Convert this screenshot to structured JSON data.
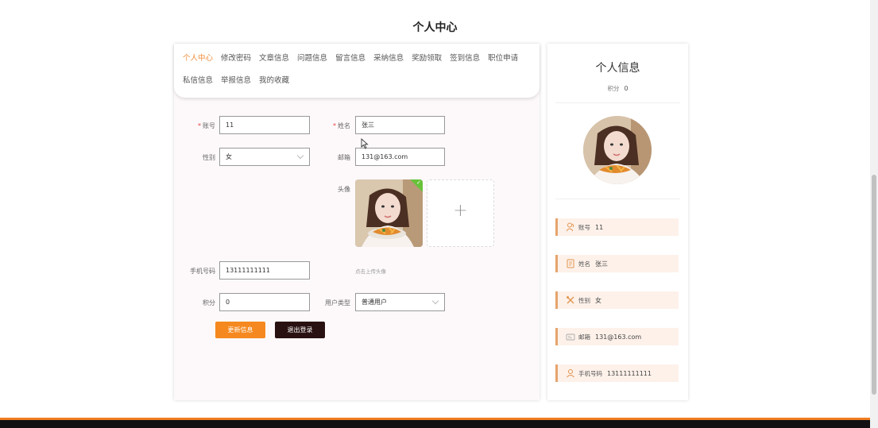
{
  "page": {
    "title": "个人中心"
  },
  "tabs": [
    {
      "label": "个人中心",
      "active": true
    },
    {
      "label": "修改密码"
    },
    {
      "label": "文章信息"
    },
    {
      "label": "问题信息"
    },
    {
      "label": "留言信息"
    },
    {
      "label": "采纳信息"
    },
    {
      "label": "奖励领取"
    },
    {
      "label": "签到信息"
    },
    {
      "label": "职位申请"
    },
    {
      "label": "私信信息"
    },
    {
      "label": "举报信息"
    },
    {
      "label": "我的收藏"
    }
  ],
  "form": {
    "account": {
      "label": "账号",
      "value": "11"
    },
    "name": {
      "label": "姓名",
      "value": "张三"
    },
    "gender": {
      "label": "性别",
      "value": "女"
    },
    "email": {
      "label": "邮箱",
      "value": "131@163.com"
    },
    "avatar": {
      "label": "头像",
      "tip": "点击上传头像"
    },
    "phone": {
      "label": "手机号码",
      "value": "13111111111"
    },
    "points": {
      "label": "积分",
      "value": "0"
    },
    "user_type": {
      "label": "用户类型",
      "value": "普通用户"
    },
    "update_button": "更新信息",
    "logout_button": "退出登录"
  },
  "side": {
    "title": "个人信息",
    "points_label": "积分",
    "points_value": "0",
    "rows": [
      {
        "key": "账号",
        "value": "11",
        "icon": "user-group-icon"
      },
      {
        "key": "姓名",
        "value": "张三",
        "icon": "document-icon"
      },
      {
        "key": "性别",
        "value": "女",
        "icon": "tools-icon"
      },
      {
        "key": "邮箱",
        "value": "131@163.com",
        "icon": "id-card-icon"
      },
      {
        "key": "手机号码",
        "value": "13111111111",
        "icon": "person-icon"
      }
    ]
  },
  "colors": {
    "accent": "#f08c39",
    "update_button": "#f5891f",
    "logout_button": "#2a1111",
    "info_row_bg": "#fdf1ea",
    "required": "#e64242"
  }
}
